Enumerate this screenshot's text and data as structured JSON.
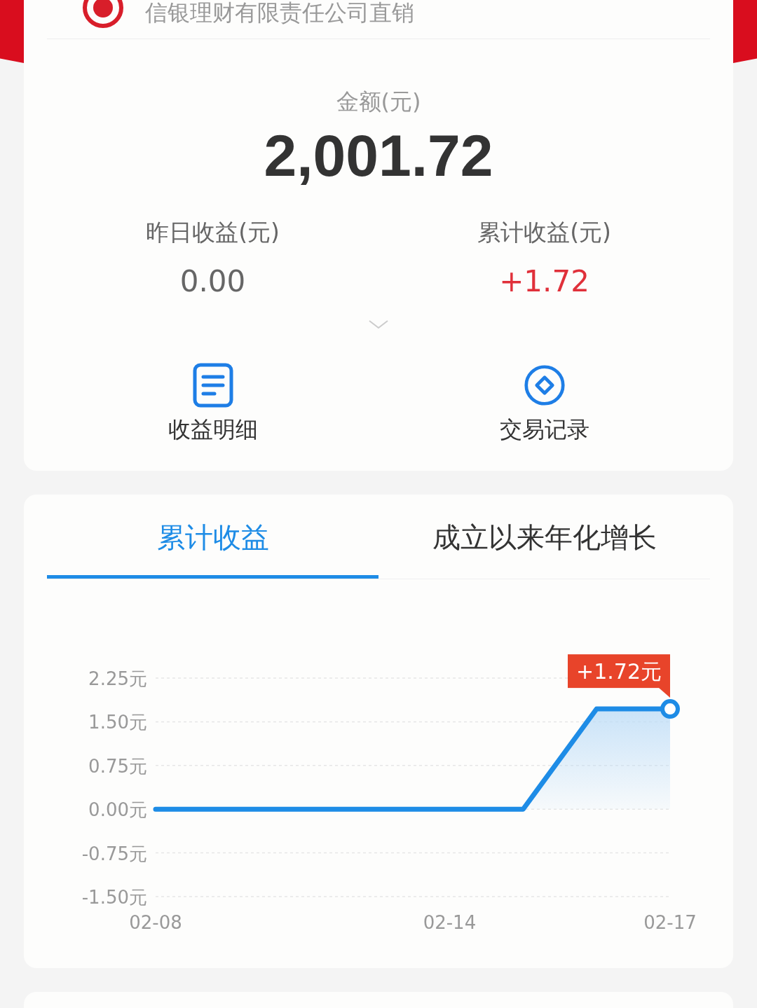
{
  "header": {
    "title": "信银理财有限责任公司直销"
  },
  "balance": {
    "label": "金额(元)",
    "value": "2,001.72"
  },
  "stats": [
    {
      "label": "昨日收益(元)",
      "value": "0.00",
      "kind": "neutral"
    },
    {
      "label": "累计收益(元)",
      "value": "+1.72",
      "kind": "positive"
    }
  ],
  "actions": [
    {
      "label": "收益明细",
      "kind": "document"
    },
    {
      "label": "交易记录",
      "kind": "diamond"
    }
  ],
  "tabs": [
    {
      "label": "累计收益",
      "selected": true
    },
    {
      "label": "成立以来年化增长",
      "selected": false
    }
  ],
  "chart": {
    "tooltip": "+1.72元",
    "chart_data": {
      "type": "area",
      "categories": [
        "02-08",
        null,
        null,
        null,
        "02-14",
        null,
        null,
        "02-17"
      ],
      "series": [
        {
          "color": "#1e8ce6",
          "values": [
            0,
            0,
            0,
            0,
            0,
            0,
            1.72,
            1.72
          ]
        }
      ],
      "ylim": [
        -1.5,
        2.25
      ],
      "grid": true,
      "yticks": [
        {
          "value": 2.25,
          "label": "2.25元"
        },
        {
          "value": 1.5,
          "label": "1.50元"
        },
        {
          "value": 0.75,
          "label": "0.75元"
        },
        {
          "value": 0,
          "label": "0.00元"
        },
        {
          "value": -0.75,
          "label": "-0.75元"
        },
        {
          "value": -1.5,
          "label": "-1.50元"
        }
      ]
    }
  }
}
